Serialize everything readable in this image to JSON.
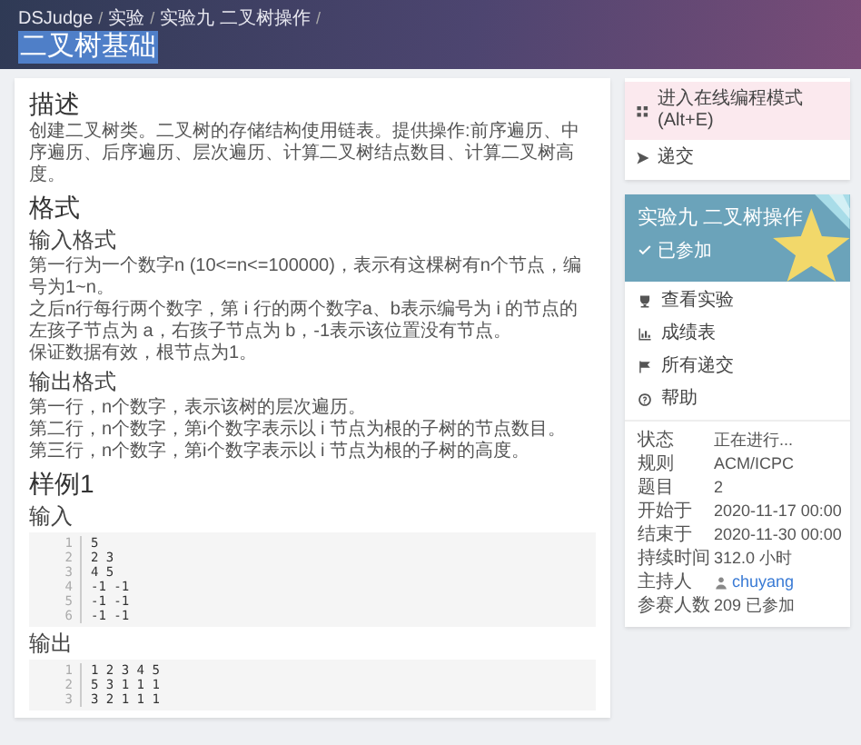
{
  "breadcrumb": [
    {
      "label": "DSJudge",
      "separator": "/"
    },
    {
      "label": "实验",
      "separator": "/"
    },
    {
      "label": "实验九 二叉树操作",
      "separator": "/"
    }
  ],
  "page_title": "二叉树基础",
  "content": [
    {
      "kind": "h1",
      "text": "描述"
    },
    {
      "kind": "p",
      "lines": [
        "创建二叉树类。二叉树的存储结构使用链表。提供操作:前序遍历、中序遍历、后序遍历、层次遍历、计算二叉树结点数目、计算二叉树高度。"
      ]
    },
    {
      "kind": "h1",
      "text": "格式"
    },
    {
      "kind": "h2",
      "text": "输入格式"
    },
    {
      "kind": "p",
      "lines": [
        "第一行为一个数字n (10<=n<=100000)，表示有这棵树有n个节点，编号为1~n。",
        "之后n行每行两个数字，第 i 行的两个数字a、b表示编号为 i 的节点的左孩子节点为 a，右孩子节点为 b，-1表示该位置没有节点。",
        "保证数据有效，根节点为1。"
      ]
    },
    {
      "kind": "h2",
      "text": "输出格式"
    },
    {
      "kind": "p",
      "lines": [
        "第一行，n个数字，表示该树的层次遍历。",
        "第二行，n个数字，第i个数字表示以 i 节点为根的子树的节点数目。",
        "第三行，n个数字，第i个数字表示以 i 节点为根的子树的高度。"
      ]
    },
    {
      "kind": "h1",
      "text": "样例1"
    },
    {
      "kind": "h2",
      "text": "输入"
    },
    {
      "kind": "code",
      "lines": [
        {
          "number": "1",
          "text": "5"
        },
        {
          "number": "2",
          "text": "2 3"
        },
        {
          "number": "3",
          "text": "4 5"
        },
        {
          "number": "4",
          "text": "-1 -1"
        },
        {
          "number": "5",
          "text": "-1 -1"
        },
        {
          "number": "6",
          "text": "-1 -1"
        }
      ]
    },
    {
      "kind": "h2",
      "text": "输出"
    },
    {
      "kind": "code",
      "lines": [
        {
          "number": "1",
          "text": "1 2 3 4 5"
        },
        {
          "number": "2",
          "text": "5 3 1 1 1"
        },
        {
          "number": "3",
          "text": "3 2 1 1 1"
        }
      ]
    }
  ],
  "actions": [
    {
      "kind": "code",
      "label": "进入在线编程模式 (Alt+E)",
      "selected": true
    },
    {
      "kind": "send",
      "label": "递交",
      "selected": false
    }
  ],
  "contest": {
    "title": "实验九 二叉树操作",
    "status": "已参加",
    "links": [
      {
        "kind": "trophy",
        "label": "查看实验"
      },
      {
        "kind": "chart",
        "label": "成绩表"
      },
      {
        "kind": "flag",
        "label": "所有递交"
      },
      {
        "kind": "help",
        "label": "帮助"
      }
    ],
    "info": [
      {
        "label": "状态",
        "value": "正在进行..."
      },
      {
        "label": "规则",
        "value": "ACM/ICPC"
      },
      {
        "label": "题目",
        "value": "2"
      },
      {
        "label": "开始于",
        "value": "2020-11-17 00:00"
      },
      {
        "label": "结束于",
        "value": "2020-11-30 00:00"
      },
      {
        "label": "持续时间",
        "value": "312.0 小时"
      },
      {
        "label": "主持人",
        "value": "chuyang",
        "kind": "user"
      },
      {
        "label": "参赛人数",
        "value": "209 已参加"
      }
    ]
  }
}
